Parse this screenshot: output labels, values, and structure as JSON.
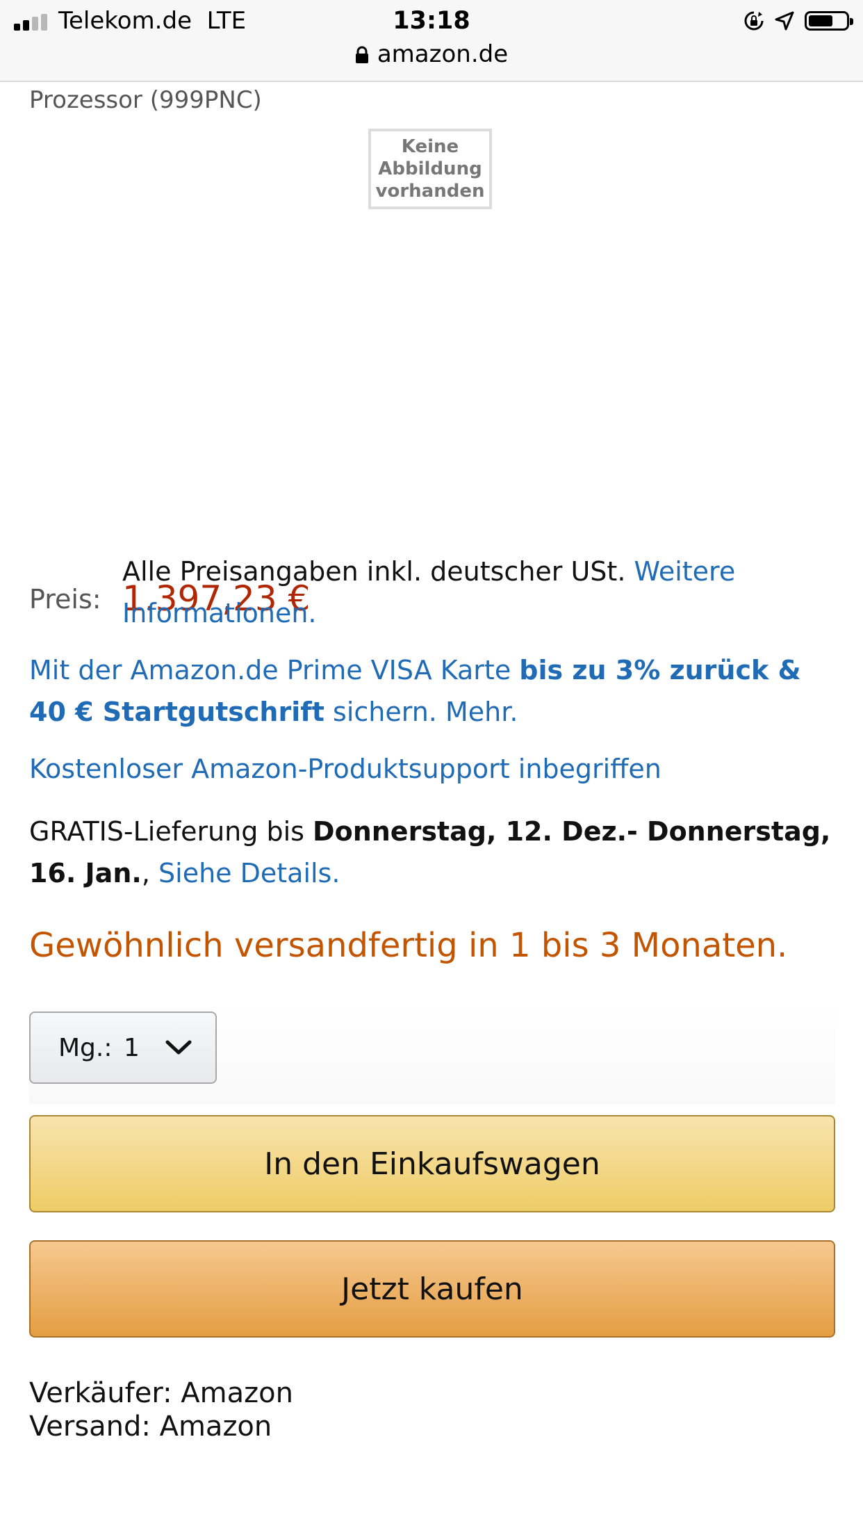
{
  "status_bar": {
    "carrier": "Telekom.de",
    "network": "LTE",
    "time": "13:18",
    "signal_bars_filled": 2,
    "signal_bars_total": 4,
    "battery_level": 0.6,
    "icons": [
      "signal-icon",
      "rotation-lock-icon",
      "location-icon",
      "battery-icon"
    ]
  },
  "browser": {
    "url": "amazon.de",
    "lock_icon": "lock-icon"
  },
  "product": {
    "title_fragment": "Prozessor (999PNC)",
    "no_image_lines": [
      "Keine",
      "Abbildung",
      "vorhanden"
    ]
  },
  "price": {
    "label": "Preis:",
    "value": "1.397,23 €",
    "color": "#b12704",
    "vat_text": "Alle Preisangaben inkl. deutscher USt.",
    "vat_link": "Weitere Informationen."
  },
  "visa_promo": {
    "text_start": "Mit der Amazon.de Prime VISA Karte",
    "text_bold": "bis zu 3% zurück & 40 € Startgutschrift",
    "text_end": "sichern.",
    "more_link": "Mehr."
  },
  "support_link": "Kostenloser Amazon-Produktsupport inbegriffen",
  "delivery": {
    "prefix": "GRATIS-Lieferung bis",
    "date_range": "Donnerstag, 12. Dez.- Donnerstag, 16. Jan.",
    "separator": ",",
    "details_link": "Siehe Details."
  },
  "availability": {
    "text": "Gewöhnlich versandfertig in 1 bis 3 Monaten.",
    "color": "#c45500"
  },
  "quantity": {
    "label": "Mg.:",
    "value": "1",
    "icon": "chevron-down-icon"
  },
  "buttons": {
    "add_to_cart": "In den Einkaufswagen",
    "buy_now": "Jetzt kaufen"
  },
  "seller_info": {
    "seller": "Verkäufer: Amazon",
    "shipping": "Versand: Amazon"
  },
  "colors": {
    "link": "#1f6bb5",
    "cart_button": "#f0d473",
    "buy_button": "#e8a44e"
  }
}
